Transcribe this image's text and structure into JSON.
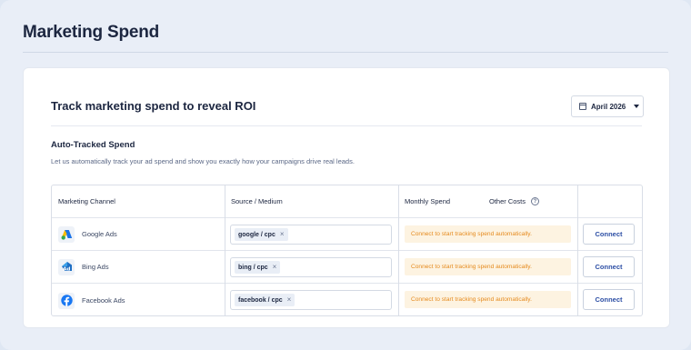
{
  "page": {
    "title": "Marketing Spend"
  },
  "card": {
    "title": "Track marketing spend to reveal ROI",
    "month": "April 2026",
    "section_title": "Auto-Tracked Spend",
    "section_desc": "Let us automatically track your ad spend and show you exactly how your campaigns drive real leads."
  },
  "table": {
    "headers": {
      "channel": "Marketing Channel",
      "source": "Source / Medium",
      "spend": "Monthly Spend",
      "other": "Other Costs"
    },
    "rows": [
      {
        "channel": "Google Ads",
        "icon": "google-ads-icon",
        "tag": "google / cpc",
        "notice": "Connect to start tracking spend automatically.",
        "action": "Connect"
      },
      {
        "channel": "Bing Ads",
        "icon": "bing-ads-icon",
        "tag": "bing / cpc",
        "notice": "Connect to start tracking spend automatically.",
        "action": "Connect"
      },
      {
        "channel": "Facebook Ads",
        "icon": "facebook-icon",
        "tag": "facebook / cpc",
        "notice": "Connect to start tracking spend automatically.",
        "action": "Connect"
      }
    ]
  },
  "colors": {
    "accent": "#2d4fa5",
    "notice_bg": "#fdf3e1",
    "notice_text": "#e58a1d",
    "background": "#e9eef7"
  }
}
